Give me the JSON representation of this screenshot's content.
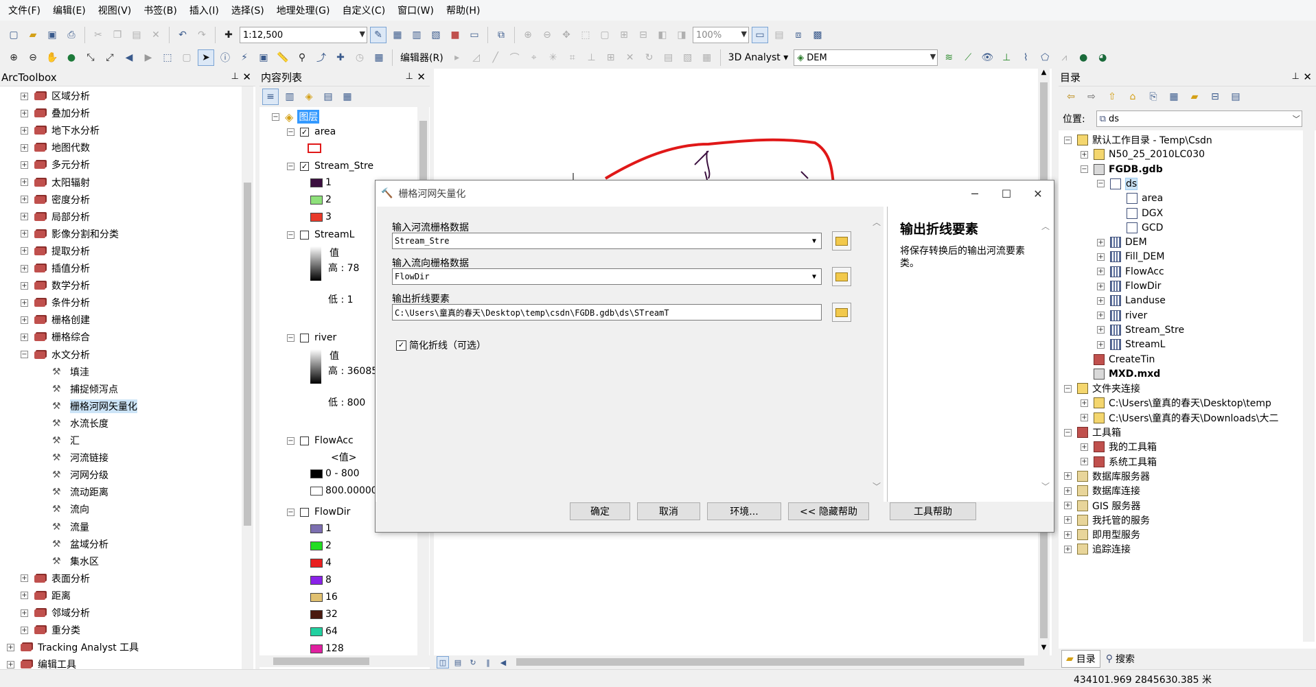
{
  "menu": [
    "文件(F)",
    "编辑(E)",
    "视图(V)",
    "书签(B)",
    "插入(I)",
    "选择(S)",
    "地理处理(G)",
    "自定义(C)",
    "窗口(W)",
    "帮助(H)"
  ],
  "toolbar": {
    "scale": "1:12,500",
    "zoom_percent": "100%",
    "editor_label": "编辑器(R)",
    "analyst_label": "3D Analyst",
    "analyst_layer": "DEM"
  },
  "arctoolbox": {
    "title": "ArcToolbox",
    "items": [
      {
        "label": "区域分析",
        "kind": "toolset"
      },
      {
        "label": "叠加分析",
        "kind": "toolset"
      },
      {
        "label": "地下水分析",
        "kind": "toolset"
      },
      {
        "label": "地图代数",
        "kind": "toolset"
      },
      {
        "label": "多元分析",
        "kind": "toolset"
      },
      {
        "label": "太阳辐射",
        "kind": "toolset"
      },
      {
        "label": "密度分析",
        "kind": "toolset"
      },
      {
        "label": "局部分析",
        "kind": "toolset"
      },
      {
        "label": "影像分割和分类",
        "kind": "toolset"
      },
      {
        "label": "提取分析",
        "kind": "toolset"
      },
      {
        "label": "插值分析",
        "kind": "toolset"
      },
      {
        "label": "数学分析",
        "kind": "toolset"
      },
      {
        "label": "条件分析",
        "kind": "toolset"
      },
      {
        "label": "栅格创建",
        "kind": "toolset"
      },
      {
        "label": "栅格综合",
        "kind": "toolset"
      },
      {
        "label": "水文分析",
        "kind": "toolset-open"
      },
      {
        "label": "填洼",
        "kind": "tool"
      },
      {
        "label": "捕捉倾泻点",
        "kind": "tool"
      },
      {
        "label": "栅格河网矢量化",
        "kind": "tool-selected"
      },
      {
        "label": "水流长度",
        "kind": "tool"
      },
      {
        "label": "汇",
        "kind": "tool"
      },
      {
        "label": "河流链接",
        "kind": "tool"
      },
      {
        "label": "河网分级",
        "kind": "tool"
      },
      {
        "label": "流动距离",
        "kind": "tool"
      },
      {
        "label": "流向",
        "kind": "tool"
      },
      {
        "label": "流量",
        "kind": "tool"
      },
      {
        "label": "盆域分析",
        "kind": "tool"
      },
      {
        "label": "集水区",
        "kind": "tool"
      },
      {
        "label": "表面分析",
        "kind": "toolset"
      },
      {
        "label": "距离",
        "kind": "toolset"
      },
      {
        "label": "邻域分析",
        "kind": "toolset"
      },
      {
        "label": "重分类",
        "kind": "toolset"
      },
      {
        "label": "Tracking Analyst 工具",
        "kind": "toolbox"
      },
      {
        "label": "编辑工具",
        "kind": "toolbox"
      }
    ]
  },
  "toc": {
    "title": "内容列表",
    "root": "图层",
    "layers": {
      "area": "area",
      "stream_stre": "Stream_Stre",
      "stream_classes": [
        {
          "label": "1",
          "color": "#3b0f3f"
        },
        {
          "label": "2",
          "color": "#8ee07a"
        },
        {
          "label": "3",
          "color": "#e83a2a"
        }
      ],
      "streaml": "StreamL",
      "value_label": "值",
      "streaml_high": "高 : 78",
      "streaml_low": "低 : 1",
      "river": "river",
      "river_high": "高 : 36085",
      "river_low": "低 : 800",
      "flowacc": "FlowAcc",
      "flowacc_value": "<值>",
      "flowacc_classes": [
        {
          "label": "0 - 800",
          "color": "#000000"
        },
        {
          "label": "800.00000",
          "color": "#ffffff"
        }
      ],
      "flowdir": "FlowDir",
      "flowdir_classes": [
        {
          "label": "1",
          "color": "#7c6fb0"
        },
        {
          "label": "2",
          "color": "#22dd22"
        },
        {
          "label": "4",
          "color": "#e82020"
        },
        {
          "label": "8",
          "color": "#8a22e8"
        },
        {
          "label": "16",
          "color": "#e0c070"
        },
        {
          "label": "32",
          "color": "#4a1a10"
        },
        {
          "label": "64",
          "color": "#22d0a0"
        },
        {
          "label": "128",
          "color": "#e020a0"
        }
      ]
    }
  },
  "dialog": {
    "title": "栅格河网矢量化",
    "label_stream_raster": "输入河流栅格数据",
    "value_stream_raster": "Stream_Stre",
    "label_flowdir": "输入流向栅格数据",
    "value_flowdir": "FlowDir",
    "label_output": "输出折线要素",
    "value_output": "C:\\Users\\童真的春天\\Desktop\\temp\\csdn\\FGDB.gdb\\ds\\STreamT",
    "simplify_label": "简化折线（可选）",
    "help_title": "输出折线要素",
    "help_text": "将保存转换后的输出河流要素类。",
    "btn_ok": "确定",
    "btn_cancel": "取消",
    "btn_env": "环境...",
    "btn_hide_help": "<< 隐藏帮助",
    "btn_tool_help": "工具帮助"
  },
  "catalog": {
    "title": "目录",
    "location_label": "位置:",
    "location_value": "ds",
    "tree": [
      {
        "label": "默认工作目录 - Temp\\Csdn",
        "indent": 0,
        "exp": "−",
        "icon": "folder"
      },
      {
        "label": "N50_25_2010LC030",
        "indent": 1,
        "exp": "+",
        "icon": "folder"
      },
      {
        "label": "FGDB.gdb",
        "indent": 1,
        "exp": "−",
        "icon": "gdb",
        "bold": true
      },
      {
        "label": "ds",
        "indent": 2,
        "exp": "−",
        "icon": "fc",
        "sel": true
      },
      {
        "label": "area",
        "indent": 3,
        "exp": "",
        "icon": "fc"
      },
      {
        "label": "DGX",
        "indent": 3,
        "exp": "",
        "icon": "fc"
      },
      {
        "label": "GCD",
        "indent": 3,
        "exp": "",
        "icon": "fc"
      },
      {
        "label": "DEM",
        "indent": 2,
        "exp": "+",
        "icon": "grid"
      },
      {
        "label": "Fill_DEM",
        "indent": 2,
        "exp": "+",
        "icon": "grid"
      },
      {
        "label": "FlowAcc",
        "indent": 2,
        "exp": "+",
        "icon": "grid"
      },
      {
        "label": "FlowDir",
        "indent": 2,
        "exp": "+",
        "icon": "grid"
      },
      {
        "label": "Landuse",
        "indent": 2,
        "exp": "+",
        "icon": "grid"
      },
      {
        "label": "river",
        "indent": 2,
        "exp": "+",
        "icon": "grid"
      },
      {
        "label": "Stream_Stre",
        "indent": 2,
        "exp": "+",
        "icon": "grid"
      },
      {
        "label": "StreamL",
        "indent": 2,
        "exp": "+",
        "icon": "grid"
      },
      {
        "label": "CreateTin",
        "indent": 1,
        "exp": "",
        "icon": "tbx"
      },
      {
        "label": "MXD.mxd",
        "indent": 1,
        "exp": "",
        "icon": "gdb",
        "bold": true
      },
      {
        "label": "文件夹连接",
        "indent": 0,
        "exp": "−",
        "icon": "folder"
      },
      {
        "label": "C:\\Users\\童真的春天\\Desktop\\temp",
        "indent": 1,
        "exp": "+",
        "icon": "folder"
      },
      {
        "label": "C:\\Users\\童真的春天\\Downloads\\大二",
        "indent": 1,
        "exp": "+",
        "icon": "folder"
      },
      {
        "label": "工具箱",
        "indent": 0,
        "exp": "−",
        "icon": "tbx"
      },
      {
        "label": "我的工具箱",
        "indent": 1,
        "exp": "+",
        "icon": "tbx"
      },
      {
        "label": "系统工具箱",
        "indent": 1,
        "exp": "+",
        "icon": "tbx"
      },
      {
        "label": "数据库服务器",
        "indent": 0,
        "exp": "+",
        "icon": "server"
      },
      {
        "label": "数据库连接",
        "indent": 0,
        "exp": "+",
        "icon": "server"
      },
      {
        "label": "GIS 服务器",
        "indent": 0,
        "exp": "+",
        "icon": "server"
      },
      {
        "label": "我托管的服务",
        "indent": 0,
        "exp": "+",
        "icon": "server"
      },
      {
        "label": "即用型服务",
        "indent": 0,
        "exp": "+",
        "icon": "server"
      },
      {
        "label": "追踪连接",
        "indent": 0,
        "exp": "+",
        "icon": "server"
      }
    ],
    "tab_catalog": "目录",
    "tab_search": "搜索"
  },
  "status": {
    "coords": "434101.969  2845630.385 米"
  }
}
